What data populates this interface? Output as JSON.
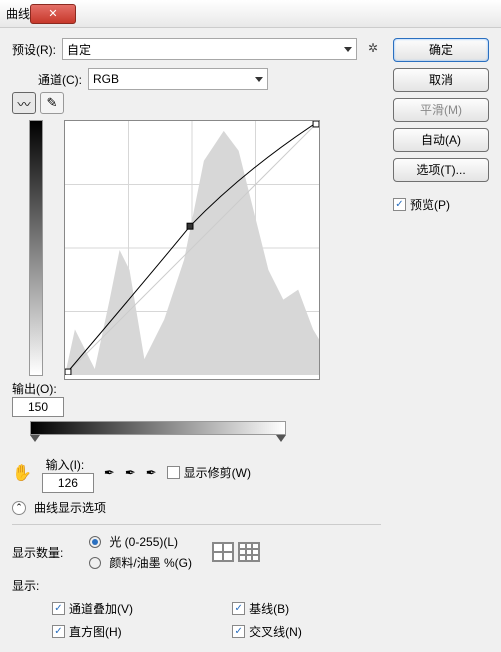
{
  "title": "曲线",
  "preset": {
    "label": "预设(R):",
    "value": "自定"
  },
  "channel": {
    "label": "通道(C):",
    "value": "RGB"
  },
  "output": {
    "label": "输出(O):",
    "value": "150"
  },
  "input": {
    "label": "输入(I):",
    "value": "126"
  },
  "show_clipping": "显示修剪(W)",
  "expander_label": "曲线显示选项",
  "amount": {
    "label": "显示数量:",
    "opt_light": "光 (0-255)(L)",
    "opt_pigment": "颜料/油墨 %(G)"
  },
  "show": {
    "label": "显示:",
    "overlay": "通道叠加(V)",
    "baseline": "基线(B)",
    "histogram": "直方图(H)",
    "intersection": "交叉线(N)"
  },
  "buttons": {
    "ok": "确定",
    "cancel": "取消",
    "smooth": "平滑(M)",
    "auto": "自动(A)",
    "options": "选项(T)..."
  },
  "preview_label": "预览(P)",
  "chart_data": {
    "type": "curve",
    "xrange": [
      0,
      255
    ],
    "yrange": [
      0,
      255
    ],
    "points": [
      [
        0,
        0
      ],
      [
        126,
        150
      ],
      [
        255,
        255
      ]
    ],
    "histogram_note": "grayscale histogram backdrop"
  }
}
